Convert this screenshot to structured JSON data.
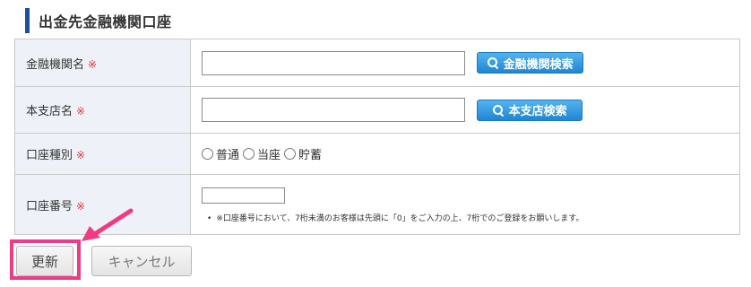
{
  "section": {
    "title": "出金先金融機関口座"
  },
  "required_mark": "※",
  "rows": {
    "bank_name": {
      "label": "金融機関名",
      "search_button": "金融機関検索"
    },
    "branch_name": {
      "label": "本支店名",
      "search_button": "本支店検索"
    },
    "account_type": {
      "label": "口座種別",
      "options": [
        "普通",
        "当座",
        "貯蓄"
      ],
      "selected": null
    },
    "account_number": {
      "label": "口座番号",
      "note": "※口座番号において、7桁未満のお客様は先頭に「0」をご入力の上、7桁でのご登録をお願いします。"
    }
  },
  "buttons": {
    "update": "更新",
    "cancel": "キャンセル"
  },
  "colors": {
    "header_bar": "#1f4e9c",
    "required": "#e0383e",
    "label_bg": "#eef2f8",
    "search_button": "#2b8fdc",
    "highlight": "#ee3b84"
  }
}
